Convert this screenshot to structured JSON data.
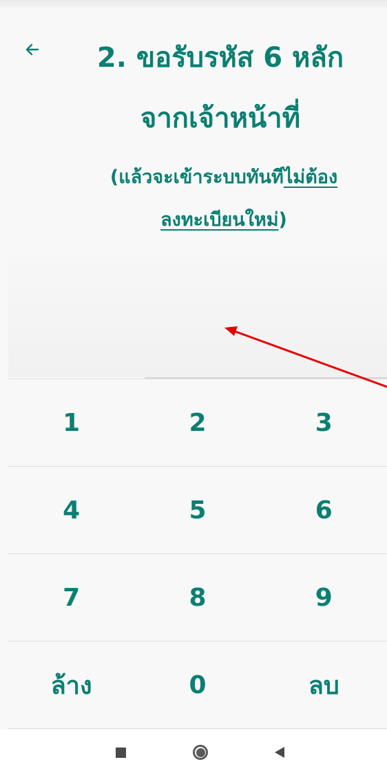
{
  "header": {
    "title_line1": "2. ขอรับรหัส 6 หลัก",
    "title_line2": "จากเจ้าหน้าที่"
  },
  "subtitle": {
    "open_paren": "(",
    "plain_text": "แล้วจะเข้าระบบทันที",
    "link_part1": "ไม่ต้อง",
    "link_part2": "ลงทะเบียนใหม่",
    "close_paren": ")"
  },
  "keypad": {
    "keys": [
      "1",
      "2",
      "3",
      "4",
      "5",
      "6",
      "7",
      "8",
      "9",
      "ล้าง",
      "0",
      "ลบ"
    ]
  },
  "colors": {
    "accent": "#0b7f72",
    "annotation_arrow": "#e60000"
  },
  "icons": {
    "back": "arrow-left-icon",
    "recents": "square-icon",
    "home": "circle-icon",
    "nav_back": "triangle-left-icon"
  }
}
